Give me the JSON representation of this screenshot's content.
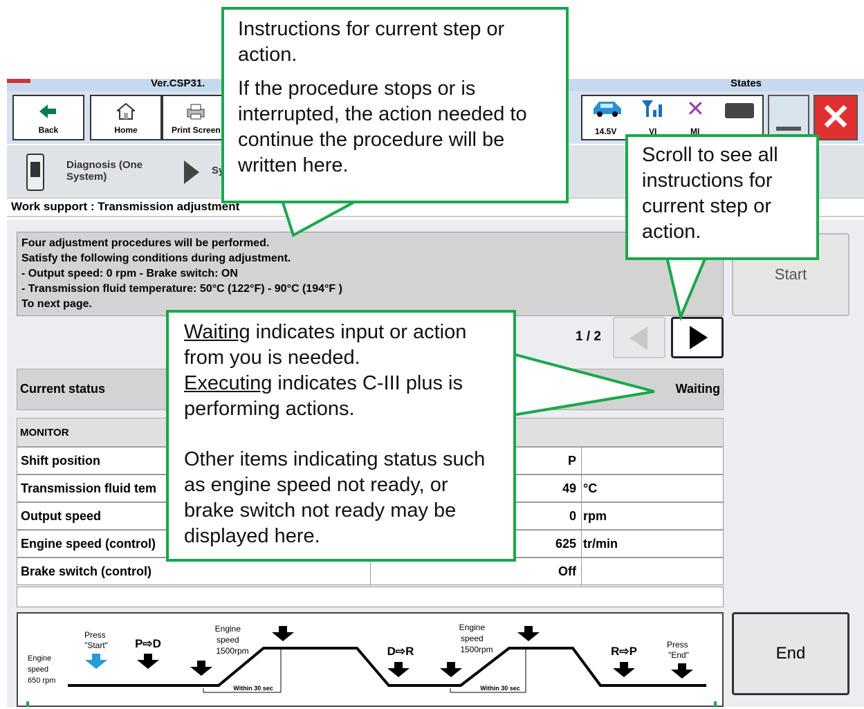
{
  "titlebar": {
    "version": "Ver.CSP31.",
    "states_label": "States"
  },
  "toolbar": {
    "back_label": "Back",
    "home_label": "Home",
    "print_label": "Print Screen",
    "voltage": "14.5V",
    "vi_label": "VI",
    "mi_label": "MI"
  },
  "breadcrumb": {
    "item1": "Diagnosis (One System)",
    "item2": "Sy"
  },
  "page_title": "Work support : Transmission adjustment",
  "instructions": {
    "lines": [
      "Four adjustment procedures will be performed.",
      "Satisfy the following conditions during adjustment.",
      "- Output speed: 0 rpm  - Brake switch: ON",
      "- Transmission fluid temperature: 50°C (122°F) - 90°C (194°F )",
      "To next page."
    ]
  },
  "start_label": "Start",
  "end_label": "End",
  "page_indicator": "1 / 2",
  "current_status": {
    "label": "Current status",
    "value": "Waiting"
  },
  "monitor": {
    "header": "MONITOR",
    "rows": [
      {
        "name": "Shift position",
        "value": "P",
        "unit": ""
      },
      {
        "name": "Transmission fluid tem",
        "value": "49",
        "unit": "°C"
      },
      {
        "name": "Output speed",
        "value": "0",
        "unit": "rpm"
      },
      {
        "name": "Engine speed (control)",
        "value": "625",
        "unit": "tr/min"
      },
      {
        "name": "Brake switch (control)",
        "value": "Off",
        "unit": ""
      }
    ]
  },
  "diagram": {
    "engine_speed_low": [
      "Engine",
      "speed",
      "650 rpm"
    ],
    "press_start": [
      "Press",
      "\"Start\""
    ],
    "press_end": [
      "Press",
      "\"End\""
    ],
    "engine_speed_high": [
      "Engine",
      "speed",
      "1500rpm"
    ],
    "shift_pd": "P⇨D",
    "shift_dr": "D⇨R",
    "shift_rp": "R⇨P",
    "within": "Within 30 sec"
  },
  "callouts": {
    "instructions_p1": "Instructions for current step or action.",
    "instructions_p2": "If the procedure stops or is interrupted, the action needed to continue the procedure will be written here.",
    "scroll": "Scroll to see all instructions for current step or action.",
    "status_waiting_word": "Waiting",
    "status_waiting_rest": " indicates input or action from you is needed.",
    "status_executing_word": "Executing",
    "status_executing_rest": " indicates C-III plus is performing actions.",
    "status_other": "Other items indicating status such as engine speed not ready, or brake switch not ready may be displayed here."
  },
  "colors": {
    "callout_border": "#19a84a",
    "toolbar_bg": "#d7e2f0",
    "close_red": "#e03030"
  }
}
